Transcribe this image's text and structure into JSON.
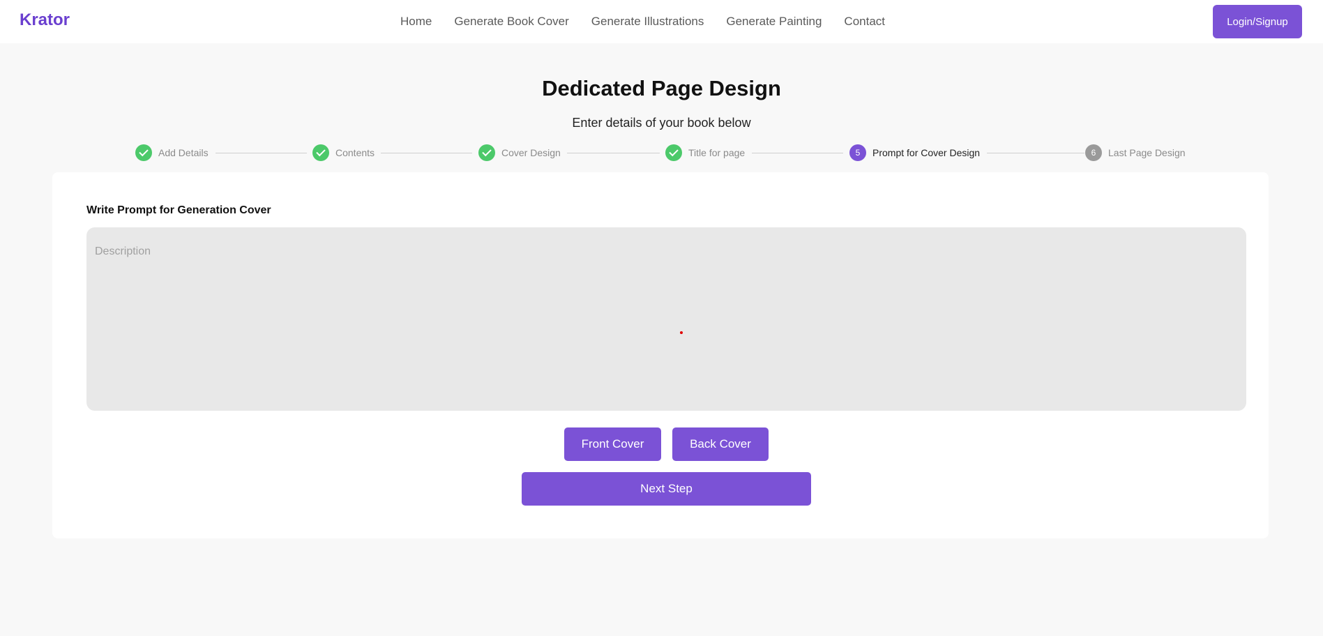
{
  "header": {
    "logo": "Krator",
    "nav": [
      "Home",
      "Generate Book Cover",
      "Generate Illustrations",
      "Generate Painting",
      "Contact"
    ],
    "login_label": "Login/Signup"
  },
  "page": {
    "title": "Dedicated Page Design",
    "subtitle": "Enter details of your book below"
  },
  "stepper": {
    "steps": [
      {
        "label": "Add Details",
        "state": "done"
      },
      {
        "label": "Contents",
        "state": "done"
      },
      {
        "label": "Cover Design",
        "state": "done"
      },
      {
        "label": "Title for page",
        "state": "done"
      },
      {
        "label": "Prompt for Cover Design",
        "state": "active",
        "number": "5"
      },
      {
        "label": "Last Page Design",
        "state": "pending",
        "number": "6"
      }
    ]
  },
  "form": {
    "prompt_label": "Write Prompt for Generation Cover",
    "description_placeholder": "Description",
    "description_value": "",
    "front_cover_label": "Front Cover",
    "back_cover_label": "Back Cover",
    "next_step_label": "Next Step"
  },
  "colors": {
    "accent": "#7b52d6",
    "logo": "#6a3fcf",
    "step_done": "#4cc96a",
    "step_pending": "#9a9a9a"
  }
}
